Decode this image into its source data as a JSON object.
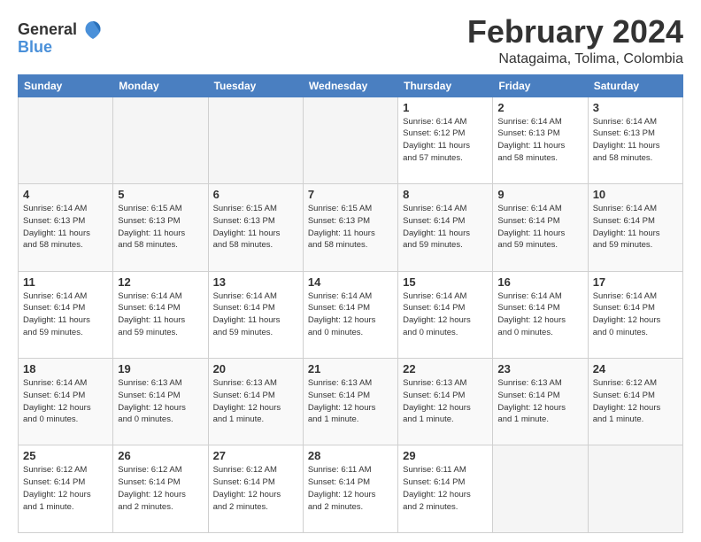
{
  "logo": {
    "general": "General",
    "blue": "Blue"
  },
  "header": {
    "month": "February 2024",
    "location": "Natagaima, Tolima, Colombia"
  },
  "weekdays": [
    "Sunday",
    "Monday",
    "Tuesday",
    "Wednesday",
    "Thursday",
    "Friday",
    "Saturday"
  ],
  "weeks": [
    [
      {
        "day": "",
        "info": ""
      },
      {
        "day": "",
        "info": ""
      },
      {
        "day": "",
        "info": ""
      },
      {
        "day": "",
        "info": ""
      },
      {
        "day": "1",
        "info": "Sunrise: 6:14 AM\nSunset: 6:12 PM\nDaylight: 11 hours\nand 57 minutes."
      },
      {
        "day": "2",
        "info": "Sunrise: 6:14 AM\nSunset: 6:13 PM\nDaylight: 11 hours\nand 58 minutes."
      },
      {
        "day": "3",
        "info": "Sunrise: 6:14 AM\nSunset: 6:13 PM\nDaylight: 11 hours\nand 58 minutes."
      }
    ],
    [
      {
        "day": "4",
        "info": "Sunrise: 6:14 AM\nSunset: 6:13 PM\nDaylight: 11 hours\nand 58 minutes."
      },
      {
        "day": "5",
        "info": "Sunrise: 6:15 AM\nSunset: 6:13 PM\nDaylight: 11 hours\nand 58 minutes."
      },
      {
        "day": "6",
        "info": "Sunrise: 6:15 AM\nSunset: 6:13 PM\nDaylight: 11 hours\nand 58 minutes."
      },
      {
        "day": "7",
        "info": "Sunrise: 6:15 AM\nSunset: 6:13 PM\nDaylight: 11 hours\nand 58 minutes."
      },
      {
        "day": "8",
        "info": "Sunrise: 6:14 AM\nSunset: 6:14 PM\nDaylight: 11 hours\nand 59 minutes."
      },
      {
        "day": "9",
        "info": "Sunrise: 6:14 AM\nSunset: 6:14 PM\nDaylight: 11 hours\nand 59 minutes."
      },
      {
        "day": "10",
        "info": "Sunrise: 6:14 AM\nSunset: 6:14 PM\nDaylight: 11 hours\nand 59 minutes."
      }
    ],
    [
      {
        "day": "11",
        "info": "Sunrise: 6:14 AM\nSunset: 6:14 PM\nDaylight: 11 hours\nand 59 minutes."
      },
      {
        "day": "12",
        "info": "Sunrise: 6:14 AM\nSunset: 6:14 PM\nDaylight: 11 hours\nand 59 minutes."
      },
      {
        "day": "13",
        "info": "Sunrise: 6:14 AM\nSunset: 6:14 PM\nDaylight: 11 hours\nand 59 minutes."
      },
      {
        "day": "14",
        "info": "Sunrise: 6:14 AM\nSunset: 6:14 PM\nDaylight: 12 hours\nand 0 minutes."
      },
      {
        "day": "15",
        "info": "Sunrise: 6:14 AM\nSunset: 6:14 PM\nDaylight: 12 hours\nand 0 minutes."
      },
      {
        "day": "16",
        "info": "Sunrise: 6:14 AM\nSunset: 6:14 PM\nDaylight: 12 hours\nand 0 minutes."
      },
      {
        "day": "17",
        "info": "Sunrise: 6:14 AM\nSunset: 6:14 PM\nDaylight: 12 hours\nand 0 minutes."
      }
    ],
    [
      {
        "day": "18",
        "info": "Sunrise: 6:14 AM\nSunset: 6:14 PM\nDaylight: 12 hours\nand 0 minutes."
      },
      {
        "day": "19",
        "info": "Sunrise: 6:13 AM\nSunset: 6:14 PM\nDaylight: 12 hours\nand 0 minutes."
      },
      {
        "day": "20",
        "info": "Sunrise: 6:13 AM\nSunset: 6:14 PM\nDaylight: 12 hours\nand 1 minute."
      },
      {
        "day": "21",
        "info": "Sunrise: 6:13 AM\nSunset: 6:14 PM\nDaylight: 12 hours\nand 1 minute."
      },
      {
        "day": "22",
        "info": "Sunrise: 6:13 AM\nSunset: 6:14 PM\nDaylight: 12 hours\nand 1 minute."
      },
      {
        "day": "23",
        "info": "Sunrise: 6:13 AM\nSunset: 6:14 PM\nDaylight: 12 hours\nand 1 minute."
      },
      {
        "day": "24",
        "info": "Sunrise: 6:12 AM\nSunset: 6:14 PM\nDaylight: 12 hours\nand 1 minute."
      }
    ],
    [
      {
        "day": "25",
        "info": "Sunrise: 6:12 AM\nSunset: 6:14 PM\nDaylight: 12 hours\nand 1 minute."
      },
      {
        "day": "26",
        "info": "Sunrise: 6:12 AM\nSunset: 6:14 PM\nDaylight: 12 hours\nand 2 minutes."
      },
      {
        "day": "27",
        "info": "Sunrise: 6:12 AM\nSunset: 6:14 PM\nDaylight: 12 hours\nand 2 minutes."
      },
      {
        "day": "28",
        "info": "Sunrise: 6:11 AM\nSunset: 6:14 PM\nDaylight: 12 hours\nand 2 minutes."
      },
      {
        "day": "29",
        "info": "Sunrise: 6:11 AM\nSunset: 6:14 PM\nDaylight: 12 hours\nand 2 minutes."
      },
      {
        "day": "",
        "info": ""
      },
      {
        "day": "",
        "info": ""
      }
    ]
  ]
}
